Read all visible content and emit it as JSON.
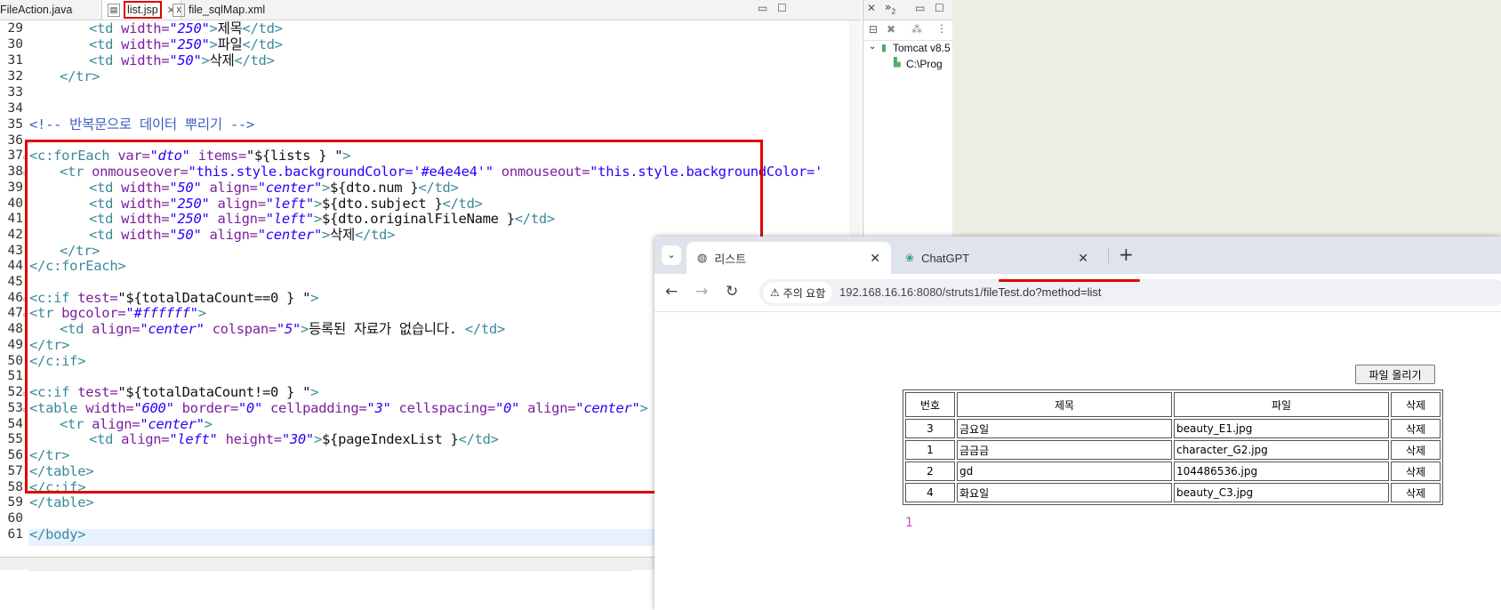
{
  "editor": {
    "tabs": [
      {
        "label": "FileAction.java"
      },
      {
        "label": "list.jsp"
      },
      {
        "label": "file_sqlMap.xml"
      }
    ],
    "line_numbers": [
      "29",
      "30",
      "31",
      "32",
      "33",
      "34",
      "35",
      "36",
      "37",
      "38",
      "39",
      "40",
      "41",
      "42",
      "43",
      "44",
      "45",
      "46",
      "47",
      "48",
      "49",
      "50",
      "51",
      "52",
      "53",
      "54",
      "55",
      "56",
      "57",
      "58",
      "59",
      "60",
      "61"
    ],
    "code": {
      "l29": {
        "t1": "<td ",
        "a1": "width=",
        "s1": "\"250\"",
        "t2": ">",
        "x": "제목",
        "t3": "</td>"
      },
      "l30": {
        "t1": "<td ",
        "a1": "width=",
        "s1": "\"250\"",
        "t2": ">",
        "x": "파일",
        "t3": "</td>"
      },
      "l31": {
        "t1": "<td ",
        "a1": "width=",
        "s1": "\"50\"",
        "t2": ">",
        "x": "삭제",
        "t3": "</td>"
      },
      "l32": {
        "t1": "</tr>"
      },
      "l35": {
        "cm": "<!-- 반복문으로 데이터 뿌리기 -->"
      },
      "l37": {
        "t1": "<c:forEach ",
        "a1": "var=",
        "s1": "\"dto\" ",
        "a2": "items=",
        "x": "\"${lists } \"",
        "t2": ">"
      },
      "l38": {
        "t1": "<tr ",
        "a1": "onmouseover=",
        "s1": "\"this.style.backgroundColor='#e4e4e4'\" ",
        "a2": "onmouseout=",
        "s2": "\"this.style.backgroundColor='"
      },
      "l39": {
        "t1": "<td ",
        "a1": "width=",
        "s1": "\"50\" ",
        "a2": "align=",
        "s2": "\"center\"",
        "t2": ">",
        "x": "${dto.num }",
        "t3": "</td>"
      },
      "l40": {
        "t1": "<td ",
        "a1": "width=",
        "s1": "\"250\" ",
        "a2": "align=",
        "s2": "\"left\"",
        "t2": ">",
        "x": "${dto.subject }",
        "t3": "</td>"
      },
      "l41": {
        "t1": "<td ",
        "a1": "width=",
        "s1": "\"250\" ",
        "a2": "align=",
        "s2": "\"left\"",
        "t2": ">",
        "x": "${dto.originalFileName }",
        "t3": "</td>"
      },
      "l42": {
        "t1": "<td ",
        "a1": "width=",
        "s1": "\"50\" ",
        "a2": "align=",
        "s2": "\"center\"",
        "t2": ">",
        "x": "삭제",
        "t3": "</td>"
      },
      "l43": {
        "t1": "</tr>"
      },
      "l44": {
        "t1": "</c:forEach>"
      },
      "l46": {
        "t1": "<c:if ",
        "a1": "test=",
        "x": "\"${totalDataCount==0 } \"",
        "t2": ">"
      },
      "l47": {
        "t1": "<tr ",
        "a1": "bgcolor=",
        "s1": "\"#ffffff\"",
        "t2": ">"
      },
      "l48": {
        "t1": "<td ",
        "a1": "align=",
        "s1": "\"center\" ",
        "a2": "colspan=",
        "s2": "\"5\"",
        "t2": ">",
        "x": "등록된 자료가 없습니다. ",
        "t3": "</td>"
      },
      "l49": {
        "t1": "</tr>"
      },
      "l50": {
        "t1": "</c:if>"
      },
      "l52": {
        "t1": "<c:if ",
        "a1": "test=",
        "x": "\"${totalDataCount!=0 } \"",
        "t2": ">"
      },
      "l53": {
        "t1": "<table ",
        "a1": "width=",
        "s1": "\"600\" ",
        "a2": "border=",
        "s2": "\"0\" ",
        "a3": "cellpadding=",
        "s3": "\"3\" ",
        "a4": "cellspacing=",
        "s4": "\"0\" ",
        "a5": "align=",
        "s5": "\"center\"",
        "t2": ">"
      },
      "l54": {
        "t1": "<tr ",
        "a1": "align=",
        "s1": "\"center\"",
        "t2": ">"
      },
      "l55": {
        "t1": "<td ",
        "a1": "align=",
        "s1": "\"left\" ",
        "a2": "height=",
        "s2": "\"30\"",
        "t2": ">",
        "x": "${pageIndexList }",
        "t3": "</td>"
      },
      "l56": {
        "t1": "</tr>"
      },
      "l57": {
        "t1": "</table>"
      },
      "l58": {
        "t1": "</c:if>"
      },
      "l59": {
        "t1": "</table>"
      },
      "l61": {
        "t1": "</body>"
      }
    }
  },
  "servers": {
    "tab_label": "2",
    "tree": {
      "server": "Tomcat v8.5",
      "path": "C:\\Prog"
    }
  },
  "browser": {
    "tabs": [
      {
        "label": "리스트"
      },
      {
        "label": "ChatGPT"
      }
    ],
    "security_label": "주의 요함",
    "url_host": "192.168.16.16:8080/struts1/",
    "url_path": "fileTest.do?method=list",
    "page": {
      "upload_button": "파일 올리기",
      "table": {
        "headers": [
          "번호",
          "제목",
          "파일",
          "삭제"
        ],
        "rows": [
          {
            "num": "3",
            "subject": "금요일",
            "file": "beauty_E1.jpg",
            "del": "삭제"
          },
          {
            "num": "1",
            "subject": "금금금",
            "file": "character_G2.jpg",
            "del": "삭제"
          },
          {
            "num": "2",
            "subject": "gd",
            "file": "104486536.jpg",
            "del": "삭제"
          },
          {
            "num": "4",
            "subject": "화요일",
            "file": "beauty_C3.jpg",
            "del": "삭제"
          }
        ]
      },
      "page_index": "1"
    }
  },
  "colors": {
    "highlight_red": "#e00000",
    "tag": "#3a8a99",
    "attr": "#7d1f9e",
    "string": "#2a00ff",
    "comment": "#3f5fbf",
    "page_index": "#c04ac8"
  }
}
